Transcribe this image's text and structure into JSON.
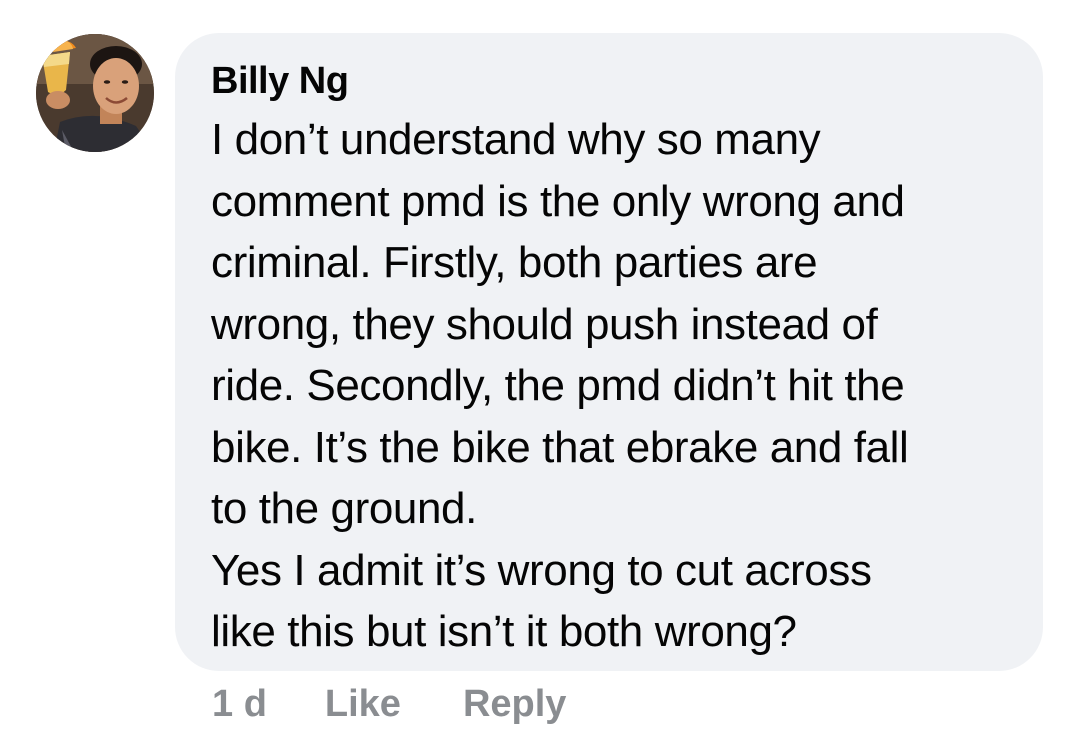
{
  "comment": {
    "author": "Billy Ng",
    "text_lines": [
      "I don’t understand why so many",
      "comment pmd is the only wrong and",
      "criminal. Firstly, both parties are",
      "wrong, they should push instead of",
      "ride. Secondly, the pmd didn’t hit the",
      "bike. It’s the bike that ebrake and fall",
      "to the ground.",
      "Yes I admit it’s wrong to cut across",
      "like this but isn’t it both wrong?"
    ],
    "timestamp": "1 d",
    "like_label": "Like",
    "reply_label": "Reply"
  },
  "colors": {
    "bubble_bg": "#f0f2f5",
    "text": "#050505",
    "meta": "#8a8d91"
  },
  "icons": {
    "avatar": "profile-photo"
  }
}
